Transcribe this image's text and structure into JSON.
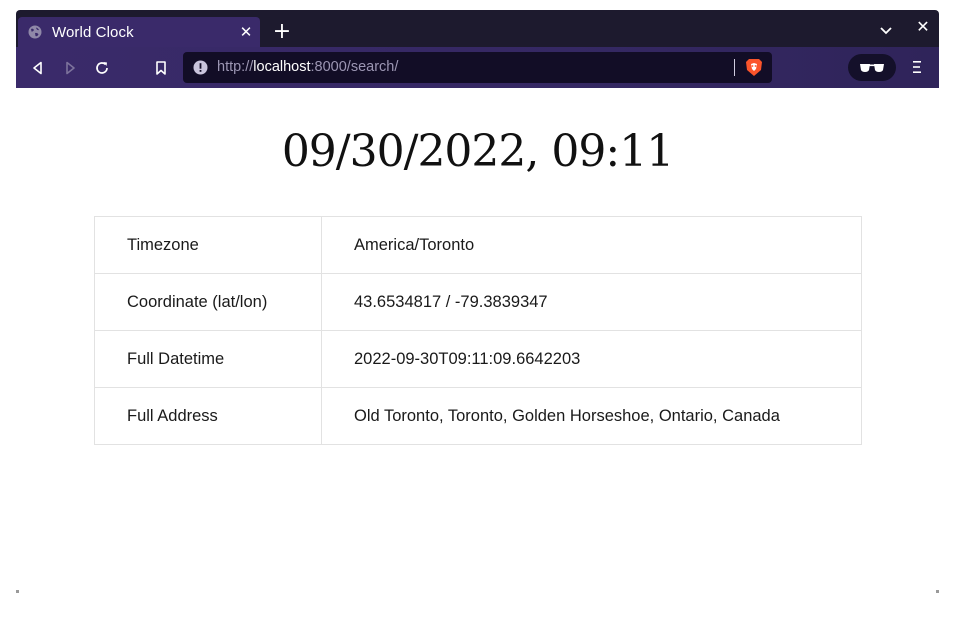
{
  "browser": {
    "tab": {
      "title": "World Clock",
      "icon": "globe-icon",
      "close_icon": "close-icon"
    },
    "new_tab_icon": "plus-icon",
    "url": {
      "scheme": "http://",
      "host": "localhost",
      "rest": ":8000/search/"
    },
    "colors": {
      "tabstrip": "#1d1a2e",
      "tab_active": "#3a2a6a",
      "urlbar": "#120d26",
      "brave_orange": "#fb542b"
    }
  },
  "page": {
    "clock": "09/30/2022, 09:11",
    "rows": [
      {
        "label": "Timezone",
        "value": "America/Toronto"
      },
      {
        "label": "Coordinate (lat/lon)",
        "value": "43.6534817 / -79.3839347"
      },
      {
        "label": "Full Datetime",
        "value": "2022-09-30T09:11:09.6642203"
      },
      {
        "label": "Full Address",
        "value": "Old Toronto, Toronto, Golden Horseshoe, Ontario, Canada"
      }
    ]
  }
}
